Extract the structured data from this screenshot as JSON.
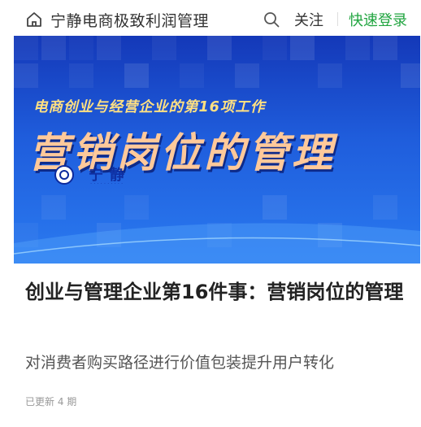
{
  "header": {
    "column_title": "宁静电商极致利润管理",
    "follow_label": "关注",
    "login_label": "快速登录",
    "icons": [
      "home-icon",
      "search-icon"
    ],
    "accent_color": "#21a540"
  },
  "banner": {
    "subtitle": "电商创业与经营企业的第16项工作",
    "title": "营销岗位的管理",
    "watermark_text": "宁静"
  },
  "article": {
    "title": "创业与管理企业第16件事：营销岗位的管理",
    "description": "对消费者购买路径进行价值包装提升用户转化",
    "update_status": "已更新 4 期"
  }
}
